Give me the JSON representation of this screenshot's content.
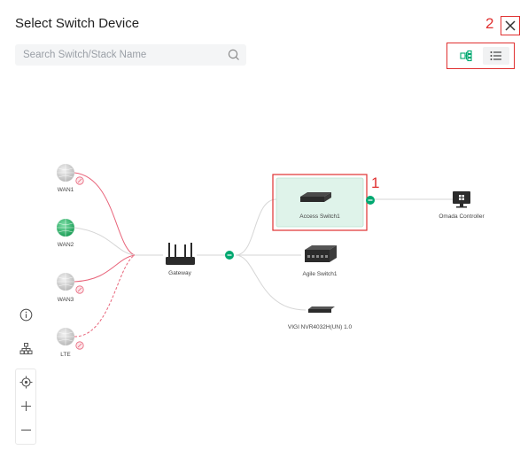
{
  "header": {
    "title": "Select Switch Device",
    "close_annotation": "2",
    "close_icon": "close-icon"
  },
  "search": {
    "placeholder": "Search Switch/Stack Name",
    "value": "",
    "icon": "search-icon"
  },
  "view_toggle": {
    "topology_icon": "topology-view-icon",
    "list_icon": "list-view-icon",
    "active": "topology"
  },
  "topology": {
    "wans": [
      {
        "label": "WAN1",
        "status": "offline"
      },
      {
        "label": "WAN2",
        "status": "online"
      },
      {
        "label": "WAN3",
        "status": "offline"
      },
      {
        "label": "LTE",
        "status": "offline"
      }
    ],
    "gateway_label": "Gateway",
    "switches": [
      {
        "label": "Access Switch1",
        "selected": true,
        "annotation": "1"
      },
      {
        "label": "Agile Switch1",
        "selected": false
      },
      {
        "label": "VIGI NVR4032H(UN) 1.0",
        "selected": false
      }
    ],
    "controller_label": "Omada Controller"
  },
  "colors": {
    "accent_green": "#00a870",
    "offline_red": "#e8647a",
    "annotation_red": "#e03030",
    "selected_fill": "#dff3ea"
  },
  "side_tools": [
    "info-icon",
    "topology-layout-icon",
    "locate-icon",
    "zoom-in-icon",
    "zoom-out-icon"
  ]
}
